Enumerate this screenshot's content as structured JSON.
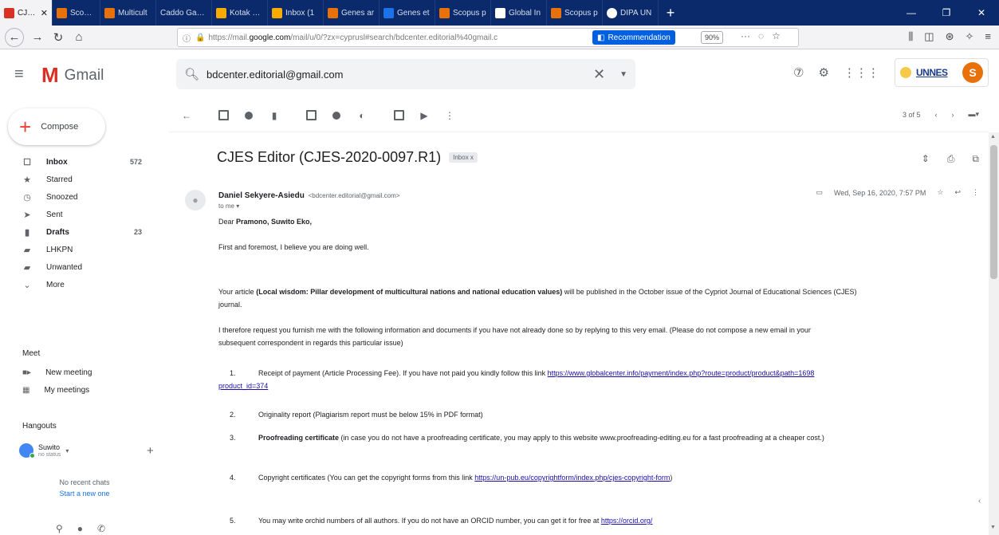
{
  "browser": {
    "tabs": [
      {
        "label": "CJES",
        "color": "#d93025",
        "active": true
      },
      {
        "label": "Scopus p",
        "color": "#e8710a"
      },
      {
        "label": "Multicult",
        "color": "#e8710a"
      },
      {
        "label": "Caddo Gap P",
        "color": "#8ab4f8"
      },
      {
        "label": "Kotak Ma",
        "color": "#f9ab00"
      },
      {
        "label": "Inbox (1",
        "color": "#f9ab00"
      },
      {
        "label": "Genes ar",
        "color": "#e8710a"
      },
      {
        "label": "Genes et",
        "color": "#1a73e8"
      },
      {
        "label": "Scopus p",
        "color": "#e8710a"
      },
      {
        "label": "Global In",
        "color": "#ffffff"
      },
      {
        "label": "Scopus p",
        "color": "#e8710a"
      },
      {
        "label": "DIPA UN",
        "color": "#ffffff"
      }
    ],
    "url_prefix": "https://mail.",
    "url_domain": "google.com",
    "url_rest": "/mail/u/0/?zx=cyprusl#search/bdcenter.editorial%40gmail.c",
    "recommendation": "Recommendation",
    "zoom": "90%"
  },
  "gmail": {
    "logo_text": "Gmail",
    "search_query": "bdcenter.editorial@gmail.com",
    "account_logo": "UNNES",
    "avatar_letter": "S"
  },
  "sidebar": {
    "compose": "Compose",
    "items": [
      {
        "label": "Inbox",
        "count": "572",
        "icon": "inbox-icon",
        "bold": true
      },
      {
        "label": "Starred",
        "count": "",
        "icon": "star-icon"
      },
      {
        "label": "Snoozed",
        "count": "",
        "icon": "clock-icon"
      },
      {
        "label": "Sent",
        "count": "",
        "icon": "send-icon"
      },
      {
        "label": "Drafts",
        "count": "23",
        "icon": "draft-icon",
        "bold": true
      },
      {
        "label": "LHKPN",
        "count": "",
        "icon": "label-icon"
      },
      {
        "label": "Unwanted",
        "count": "",
        "icon": "label-icon"
      },
      {
        "label": "More",
        "count": "",
        "icon": "chevron-down-icon"
      }
    ],
    "meet_label": "Meet",
    "new_meeting": "New meeting",
    "my_meetings": "My meetings",
    "hangouts_label": "Hangouts",
    "hangout_user": "Suwito",
    "hangout_status": "no status",
    "no_recent": "No recent chats",
    "start_new": "Start a new one"
  },
  "toolbar": {
    "pager": "3 of 5"
  },
  "email": {
    "subject": "CJES Editor (CJES-2020-0097.R1)",
    "label_chip": "Inbox x",
    "sender_name": "Daniel Sekyere-Asiedu",
    "sender_email": "<bdcenter.editorial@gmail.com>",
    "to": "to me",
    "date": "Wed, Sep 16, 2020, 7:57 PM",
    "greeting_prefix": "Dear ",
    "greeting_name": "Pramono, Suwito Eko,",
    "line1": "First and foremost, I believe you are doing well.",
    "line2_a": "Your article ",
    "line2_b": "(Local wisdom: Pillar development of multicultural nations and national education values)",
    "line2_c": " will be published in the October issue of the Cypriot Journal of Educational Sciences (CJES)",
    "line2_d": "journal.",
    "line3_a": "I therefore request you furnish me with the following information and documents if you have not already done so by replying to this very email. (Please do not compose a new email in your",
    "line3_b": "subsequent correspondent in regards this particular issue)",
    "item1_num": "1.",
    "item1_text": "Receipt of payment (Article Processing Fee). If you have not paid you kindly follow this link ",
    "item1_link": "https://www.globalcenter.info/payment/index.php?route=product/product&path=1698",
    "item1_link2": "product_id=374",
    "item2_num": "2.",
    "item2_text": "Originality report (Plagiarism report must be below 15% in PDF format)",
    "item3_num": "3.",
    "item3_bold": "Proofreading certificate",
    "item3_text": " (in case you do not have a proofreading certificate, you may apply to this website www.proofreading-editing.eu for a fast proofreading at a cheaper cost.)",
    "item4_num": "4.",
    "item4_text": "Copyright certificates (You can get the copyright forms from this link ",
    "item4_link": "https://un-pub.eu/copyrightform/index.php/cjes-copyright-form",
    "item4_end": ")",
    "item5_num": "5.",
    "item5_text": "You may write orchid numbers of all authors. If you do not have an ORCID number, you can get it for free at ",
    "item5_link": "https://orcid.org/"
  }
}
